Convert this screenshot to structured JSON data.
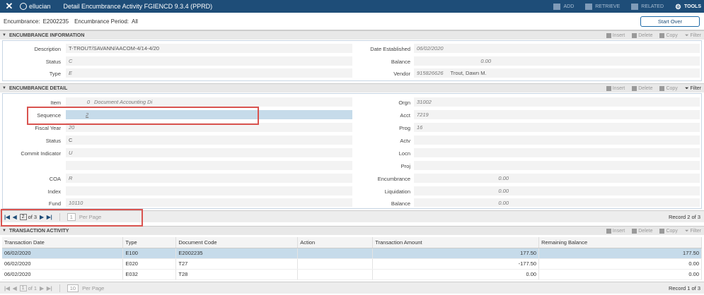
{
  "topbar": {
    "brand": "ellucian",
    "title": "Detail Encumbrance Activity FGIENCD 9.3.4 (PPRD)",
    "actions": [
      {
        "label": "ADD",
        "icon": "add-icon"
      },
      {
        "label": "RETRIEVE",
        "icon": "retrieve-icon"
      },
      {
        "label": "RELATED",
        "icon": "related-icon"
      },
      {
        "label": "TOOLS",
        "icon": "gear-icon"
      }
    ]
  },
  "keyblock": {
    "encumbrance_label": "Encumbrance:",
    "encumbrance_value": "E2002235",
    "period_label": "Encumbrance Period:",
    "period_value": "All",
    "start_over": "Start Over"
  },
  "toolbar": {
    "insert": "Insert",
    "delete": "Delete",
    "copy": "Copy",
    "filter": "Filter"
  },
  "info": {
    "header": "ENCUMBRANCE INFORMATION",
    "description_label": "Description",
    "description": "T-TROUT/SAVANN/AACOM-4/14-4/20",
    "status_label": "Status",
    "status": "C",
    "type_label": "Type",
    "type": "E",
    "date_established_label": "Date Established",
    "date_established": "06/02/2020",
    "balance_label": "Balance",
    "balance": "0.00",
    "vendor_label": "Vendor",
    "vendor_id": "915826626",
    "vendor_name": "Trout, Dawn M."
  },
  "detail": {
    "header": "ENCUMBRANCE DETAIL",
    "item_label": "Item",
    "item": "0",
    "item_desc": "Document Accounting Di",
    "sequence_label": "Sequence",
    "sequence": "2",
    "fiscal_year_label": "Fiscal Year",
    "fiscal_year": "20",
    "status_label": "Status",
    "status": "C",
    "commit_label": "Commit Indicator",
    "commit": "U",
    "coa_label": "COA",
    "coa": "R",
    "index_label": "Index",
    "index": "",
    "fund_label": "Fund",
    "fund": "10110",
    "orgn_label": "Orgn",
    "orgn": "31002",
    "acct_label": "Acct",
    "acct": "7219",
    "prog_label": "Prog",
    "prog": "16",
    "actv_label": "Actv",
    "actv": "",
    "locn_label": "Locn",
    "locn": "",
    "proj_label": "Proj",
    "proj": "",
    "encumbrance_label": "Encumbrance",
    "encumbrance": "0.00",
    "liquidation_label": "Liquidation",
    "liquidation": "0.00",
    "balance_label": "Balance",
    "balance": "0.00"
  },
  "detail_pager": {
    "page": "2",
    "of_label": "of 3",
    "per_page_value": "1",
    "per_page_label": "Per Page",
    "record_text": "Record 2 of 3"
  },
  "activity": {
    "header": "TRANSACTION ACTIVITY",
    "columns": [
      "Transaction Date",
      "Type",
      "Document Code",
      "Action",
      "Transaction Amount",
      "Remaining Balance"
    ],
    "rows": [
      [
        "06/02/2020",
        "E100",
        "E2002235",
        "",
        "177.50",
        "177.50"
      ],
      [
        "06/02/2020",
        "E020",
        "T27",
        "",
        "-177.50",
        "0.00"
      ],
      [
        "06/02/2020",
        "E032",
        "T28",
        "",
        "0.00",
        "0.00"
      ]
    ]
  },
  "activity_pager": {
    "page": "1",
    "of_label": "of 1",
    "per_page_value": "10",
    "per_page_label": "Per Page",
    "record_text": "Record 1 of 3"
  },
  "colors": {
    "topbar": "#1e4d78",
    "selected": "#c6dbea",
    "highlight": "#d9534f"
  }
}
